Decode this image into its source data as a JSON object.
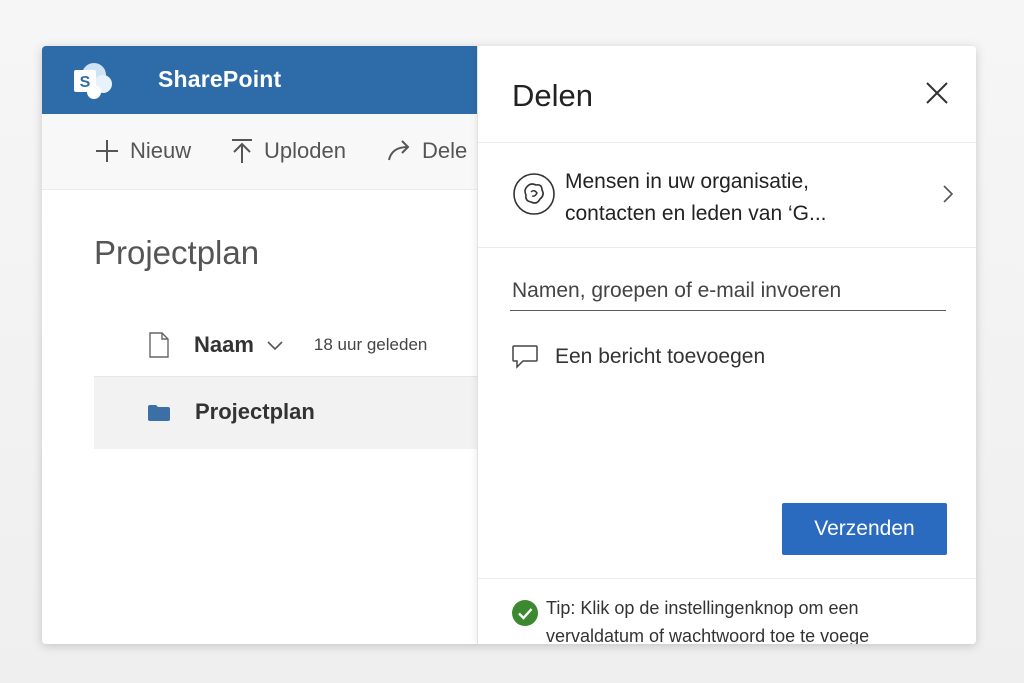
{
  "app": {
    "title": "SharePoint",
    "logo_letter": "S",
    "brand_color": "#2e6ca9"
  },
  "command_bar": {
    "new_label": "Nieuw",
    "upload_label": "Uploden",
    "share_label": "Dele"
  },
  "page": {
    "title": "Projectplan"
  },
  "list": {
    "header_name": "Naam",
    "header_modified": "18 uur geleden",
    "rows": [
      {
        "name": "Projectplan",
        "icon": "folder-icon"
      }
    ]
  },
  "share_panel": {
    "title": "Delen",
    "audience_line1": "Mensen in uw organisatie,",
    "audience_line2": "contacten en leden van ‘G...",
    "input_placeholder": "Namen, groepen of e-mail invoeren",
    "input_value": "",
    "message_label": "Een bericht toevoegen",
    "send_label": "Verzenden",
    "send_color": "#2b6bbf",
    "tip_line1": "Tip: Klik op de instellingenknop om een",
    "tip_line2": "vervaldatum of wachtwoord toe te voege",
    "tip_icon_color": "#3c8a2f"
  }
}
